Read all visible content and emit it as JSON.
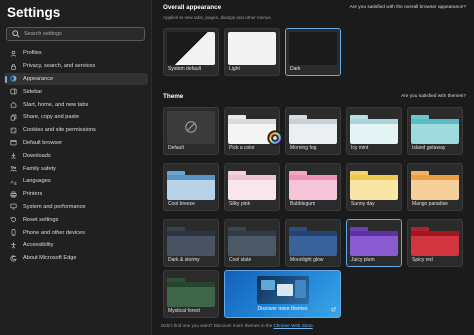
{
  "sidebar": {
    "title": "Settings",
    "search_placeholder": "Search settings",
    "items": [
      {
        "label": "Profiles",
        "icon": "profile-icon"
      },
      {
        "label": "Privacy, search, and services",
        "icon": "lock-icon"
      },
      {
        "label": "Appearance",
        "icon": "appearance-icon",
        "active": true
      },
      {
        "label": "Sidebar",
        "icon": "sidebar-icon"
      },
      {
        "label": "Start, home, and new tabs",
        "icon": "home-icon"
      },
      {
        "label": "Share, copy and paste",
        "icon": "share-icon"
      },
      {
        "label": "Cookies and site permissions",
        "icon": "cookie-icon"
      },
      {
        "label": "Default browser",
        "icon": "browser-icon"
      },
      {
        "label": "Downloads",
        "icon": "download-icon"
      },
      {
        "label": "Family safety",
        "icon": "family-icon"
      },
      {
        "label": "Languages",
        "icon": "languages-icon"
      },
      {
        "label": "Printers",
        "icon": "printer-icon"
      },
      {
        "label": "System and performance",
        "icon": "system-icon"
      },
      {
        "label": "Reset settings",
        "icon": "reset-icon"
      },
      {
        "label": "Phone and other devices",
        "icon": "phone-icon"
      },
      {
        "label": "Accessibility",
        "icon": "accessibility-icon"
      },
      {
        "label": "About Microsoft Edge",
        "icon": "edge-icon"
      }
    ]
  },
  "overall": {
    "title": "Overall appearance",
    "subtitle": "Applies to new tabs, pages, dialogs and other menus",
    "feedback": "Are you satisfied with the overall browser appearance?",
    "options": [
      {
        "label": "System default"
      },
      {
        "label": "Light"
      },
      {
        "label": "Dark",
        "selected": true
      }
    ]
  },
  "theme": {
    "title": "Theme",
    "feedback": "Are you satisfied with themes?",
    "items": [
      {
        "label": "Default",
        "kind": "default"
      },
      {
        "label": "Pick a color",
        "kind": "pick"
      },
      {
        "label": "Morning fog",
        "tab": "#d7dbe0",
        "stripe": "#c9d0d8",
        "body": "#eceff2"
      },
      {
        "label": "Icy mint",
        "tab": "#b9dfe3",
        "stripe": "#a8d6db",
        "body": "#e4f3f4"
      },
      {
        "label": "Island getaway",
        "tab": "#6fc7cc",
        "stripe": "#5bbcc2",
        "body": "#9fdadd"
      },
      {
        "label": "Cool breeze",
        "tab": "#6aa6d0",
        "stripe": "#5796c4",
        "body": "#b6d3e9"
      },
      {
        "label": "Silky pink",
        "tab": "#f2d2dc",
        "stripe": "#ecc4d1",
        "body": "#f8e6ec"
      },
      {
        "label": "Bubblegum",
        "tab": "#f3a7c6",
        "stripe": "#ee93b8",
        "body": "#f7c5da"
      },
      {
        "label": "Sunny day",
        "tab": "#f3d36a",
        "stripe": "#efc84f",
        "body": "#f8e6a6"
      },
      {
        "label": "Mango paradise",
        "tab": "#f2b264",
        "stripe": "#ee9f44",
        "body": "#f7cf98"
      },
      {
        "label": "Dark & stormy",
        "tab": "#3a4250",
        "stripe": "#2e3542",
        "body": "#4a5362"
      },
      {
        "label": "Cool slate",
        "tab": "#3b4652",
        "stripe": "#303a45",
        "body": "#4b5866"
      },
      {
        "label": "Moonlight glow",
        "tab": "#2b4f7d",
        "stripe": "#244470",
        "body": "#3a629a"
      },
      {
        "label": "Juicy plum",
        "tab": "#6c3fb3",
        "stripe": "#5d33a3",
        "body": "#8a5ad0",
        "selected": true
      },
      {
        "label": "Spicy red",
        "tab": "#b3202a",
        "stripe": "#9f1820",
        "body": "#d03540"
      },
      {
        "label": "Mystical forest",
        "tab": "#2f4f3a",
        "stripe": "#27442f",
        "body": "#3f6548"
      },
      {
        "label": "Discover more themes",
        "kind": "discover"
      }
    ]
  },
  "footer": {
    "prefix": "Didn't find one you want? Discover more themes in the ",
    "link": "Chrome Web Store",
    "suffix": "."
  }
}
